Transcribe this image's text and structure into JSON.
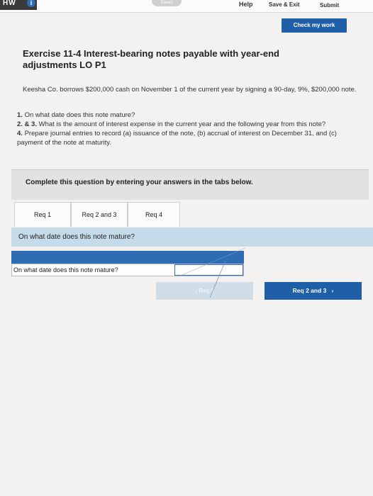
{
  "topbar": {
    "hw_label": "HW",
    "info_icon": "i",
    "saved_label": "Saved",
    "help": "Help",
    "save_exit": "Save & Exit",
    "submit": "Submit"
  },
  "check_my_work": "Check my work",
  "exercise": {
    "title": "Exercise 11-4 Interest-bearing notes payable with year-end adjustments LO P1",
    "problem": "Keesha Co. borrows $200,000 cash on November 1 of the current year by signing a 90-day, 9%, $200,000 note.",
    "q1": "On what date does this note mature?",
    "q1_num": "1.",
    "q23_num": "2. & 3.",
    "q23": "What is the amount of interest expense in the current year and the following year from this note?",
    "q4_num": "4.",
    "q4": "Prepare journal entries to record (a) issuance of the note, (b) accrual of interest on December 31, and (c) payment of the note at maturity."
  },
  "instruction": "Complete this question by entering your answers in the tabs below.",
  "tabs": [
    {
      "label": "Req 1"
    },
    {
      "label": "Req 2 and 3"
    },
    {
      "label": "Req 4"
    }
  ],
  "question_prompt": "On what date does this note mature?",
  "answer_row": {
    "label": "On what date does this note mature?",
    "value": ""
  },
  "nav": {
    "prev": "Req 1",
    "next": "Req 2 and 3"
  },
  "colors": {
    "primary": "#1f5fa8",
    "question_bar": "#c6dbe9",
    "page_bg": "#f3f2f0"
  }
}
